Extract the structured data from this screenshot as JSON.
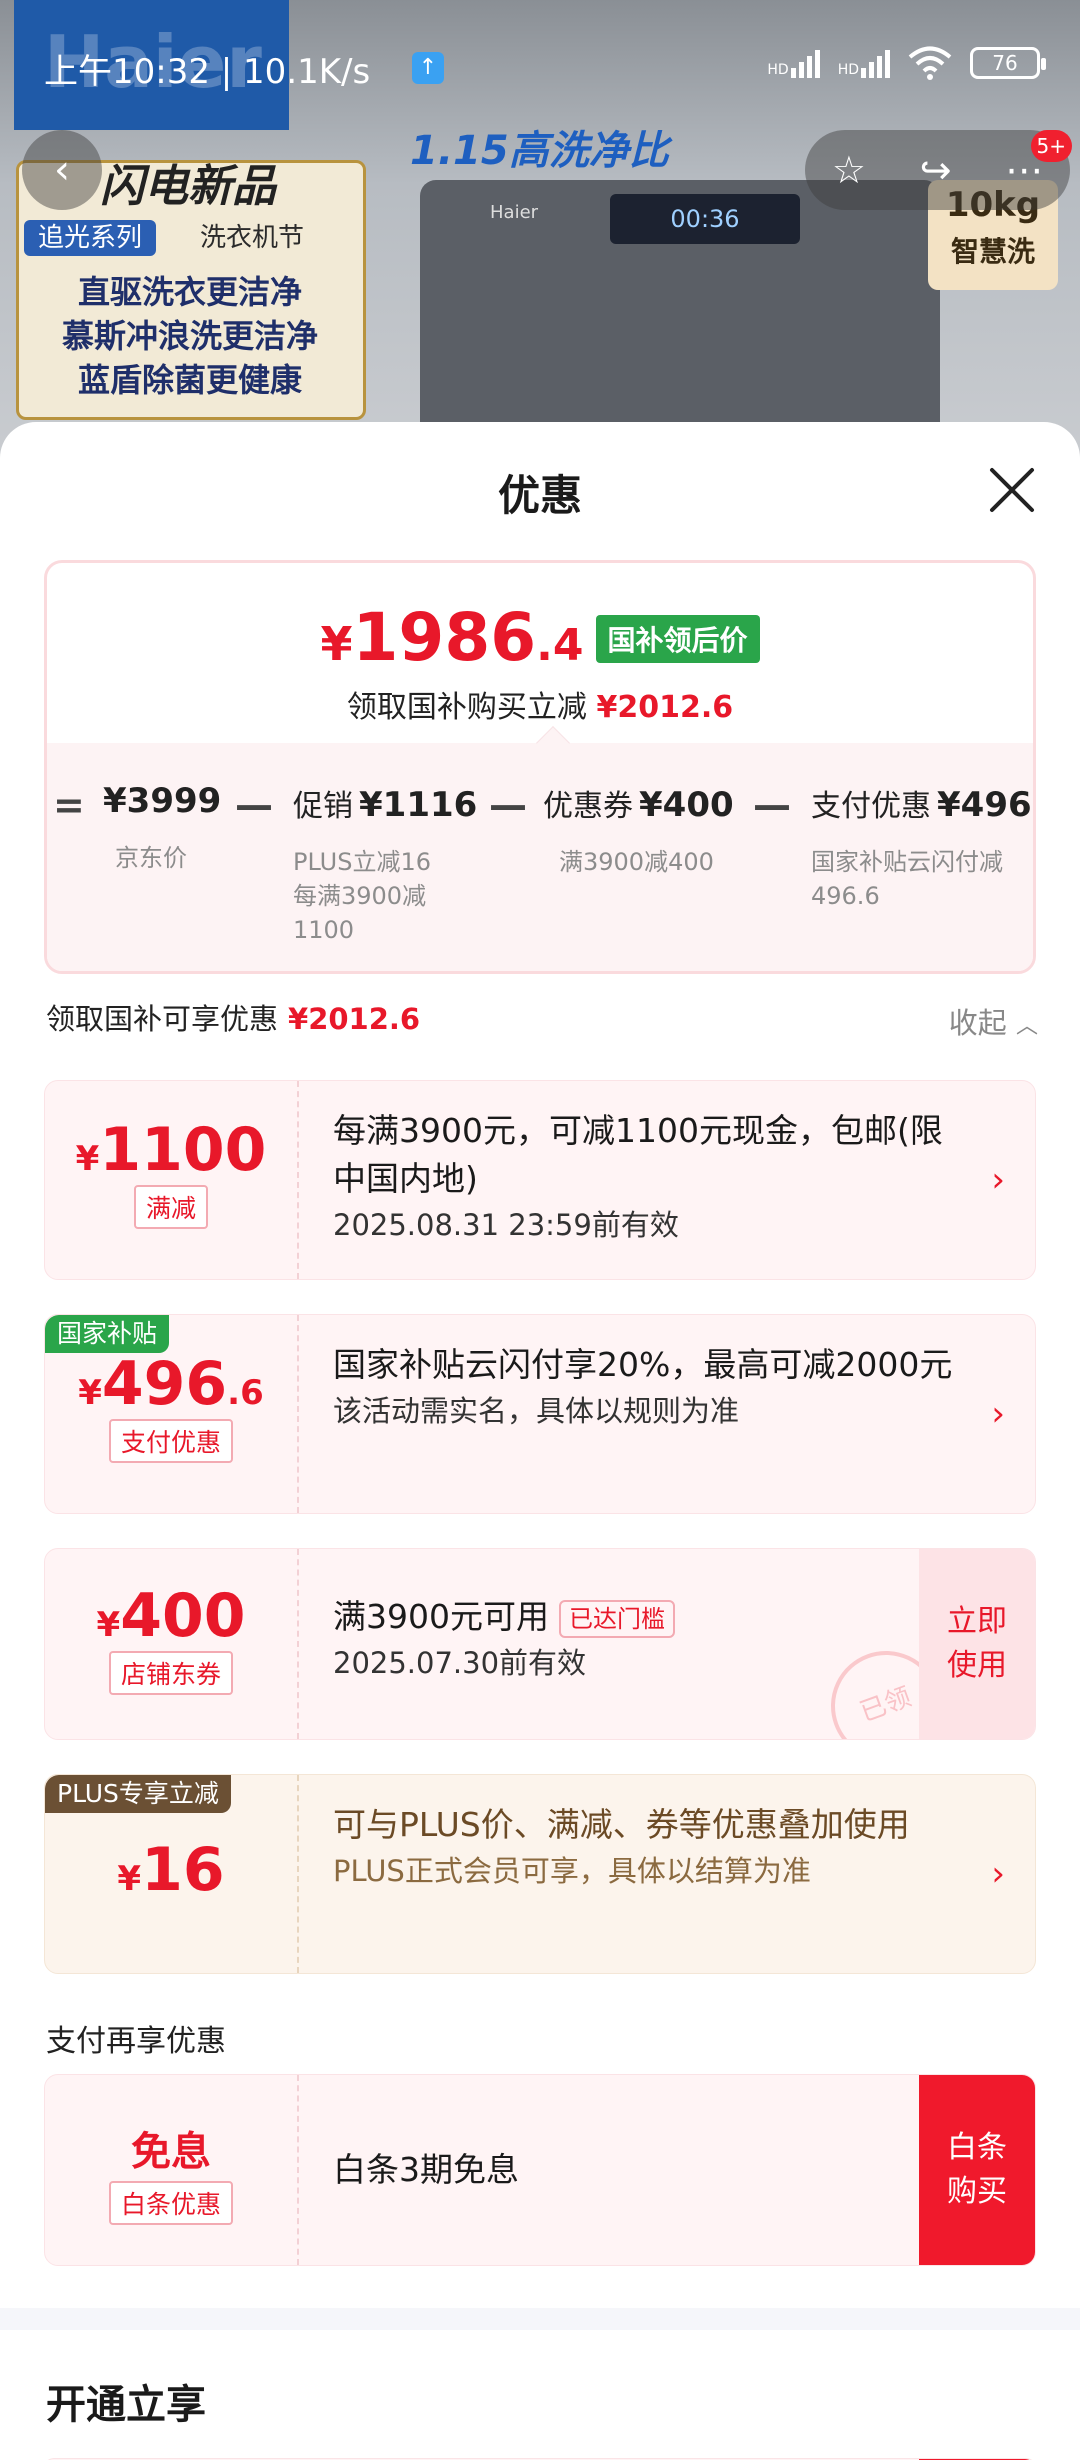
{
  "status_bar": {
    "time_speed": "上午10:32 | 10.1K/s",
    "network_1": "HD",
    "network_2": "HD",
    "battery": "76"
  },
  "hero": {
    "logo": "Haier",
    "promo": "1.15高洗净比",
    "brand": "闪电新品",
    "series": "追光系列",
    "festival": "洗衣机节",
    "feature_lines": [
      "直驱洗衣更洁净",
      "慕斯冲浪洗更洁净",
      "蓝盾除菌更健康"
    ],
    "machine_brand": "Haier",
    "panel_display": "00:36",
    "capacity": "10kg",
    "capacity_sub": "智慧洗",
    "nav_badge": "5+"
  },
  "sheet": {
    "title": "优惠"
  },
  "summary": {
    "price_yen": "¥",
    "price_int": "1986",
    "price_dec": ".4",
    "price_tag": "国补领后价",
    "sub_text": "领取国补购买立减",
    "sub_amount": "¥2012.6",
    "calc": {
      "op_eq": "=",
      "op_minus": "—",
      "items": [
        {
          "label": "",
          "value": "¥3999",
          "notes": [
            "京东价"
          ]
        },
        {
          "label": "促销",
          "value": "¥1116",
          "notes": [
            "PLUS立减16",
            "每满3900减",
            "1100"
          ]
        },
        {
          "label": "优惠券",
          "value": "¥400",
          "notes": [
            "满3900减400"
          ]
        },
        {
          "label": "支付优惠",
          "value": "¥496",
          "notes": [
            "国家补贴云闪付减",
            "496.6"
          ]
        }
      ]
    }
  },
  "section": {
    "label": "领取国补可享优惠",
    "amount": "¥2012.6",
    "collapse_label": "收起"
  },
  "coupons": [
    {
      "yen": "¥",
      "amount": "1100",
      "dec": "",
      "tag": "满减",
      "main": "每满3900元，可减1100元现金，包邮(限中国内地)",
      "sub": "2025.08.31 23:59前有效"
    },
    {
      "corner": "国家补贴",
      "yen": "¥",
      "amount": "496",
      "dec": ".6",
      "tag": "支付优惠",
      "main": "国家补贴云闪付享20%，最高可减2000元",
      "sub": "该活动需实名，具体以规则为准"
    },
    {
      "yen": "¥",
      "amount": "400",
      "dec": "",
      "tag": "店铺东券",
      "main": "满3900元可用",
      "reached": "已达门槛",
      "sub": "2025.07.30前有效",
      "action": "立即使用",
      "stamp": "已领"
    },
    {
      "corner": "PLUS专享立减",
      "yen": "¥",
      "amount": "16",
      "dec": "",
      "main": "可与PLUS价、满减、券等优惠叠加使用",
      "sub": "PLUS正式会员可享，具体以结算为准"
    }
  ],
  "pay_section": {
    "label": "支付再享优惠",
    "card": {
      "amount": "免息",
      "tag": "白条优惠",
      "main": "白条3期免息",
      "action": "白条购买"
    }
  },
  "open_section": {
    "label": "开通立享"
  },
  "colors": {
    "accent_red": "#e8182a",
    "tag_green": "#2aa54a",
    "plus_brown": "#6b5034"
  }
}
